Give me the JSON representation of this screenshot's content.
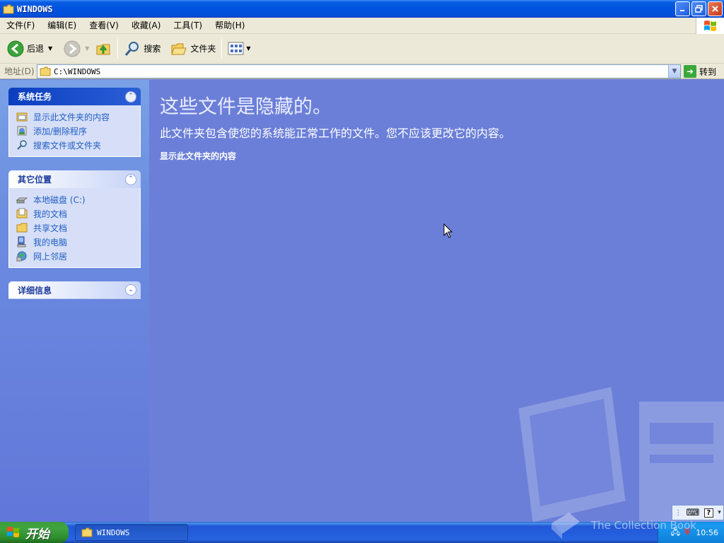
{
  "window": {
    "title": "WINDOWS",
    "buttons": [
      "minimize",
      "restore",
      "close"
    ]
  },
  "menubar": {
    "items": [
      "文件(F)",
      "编辑(E)",
      "查看(V)",
      "收藏(A)",
      "工具(T)",
      "帮助(H)"
    ]
  },
  "toolbar": {
    "back_label": "后退",
    "search_label": "搜索",
    "folders_label": "文件夹"
  },
  "address": {
    "label": "地址(D)",
    "value": "C:\\WINDOWS",
    "go_label": "转到"
  },
  "tasks": {
    "system": {
      "title": "系统任务",
      "links": [
        "显示此文件夹的内容",
        "添加/删除程序",
        "搜索文件或文件夹"
      ]
    },
    "other_places": {
      "title": "其它位置",
      "links": [
        "本地磁盘 (C:)",
        "我的文档",
        "共享文档",
        "我的电脑",
        "网上邻居"
      ]
    },
    "details": {
      "title": "详细信息"
    }
  },
  "main": {
    "heading": "这些文件是隐藏的。",
    "subtitle": "此文件夹包含使您的系统能正常工作的文件。您不应该更改它的内容。",
    "show_link": "显示此文件夹的内容"
  },
  "taskbar": {
    "start_label": "开始",
    "task_button": "WINDOWS",
    "clock": "10:56",
    "watermark": "The Collection Book"
  },
  "colors": {
    "content_bg": "#6b7fd8",
    "taskbar_blue": "#2663e0",
    "start_green": "#3fa43f",
    "link_blue": "#215dc6"
  }
}
